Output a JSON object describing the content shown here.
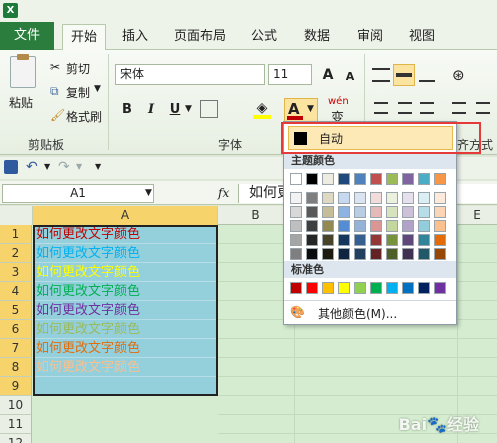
{
  "tabs": [
    {
      "label": "文件"
    },
    {
      "label": "开始"
    },
    {
      "label": "插入"
    },
    {
      "label": "页面布局"
    },
    {
      "label": "公式"
    },
    {
      "label": "数据"
    },
    {
      "label": "审阅"
    },
    {
      "label": "视图"
    }
  ],
  "ribbon": {
    "clipboard": {
      "paste": "粘贴",
      "cut": "剪切",
      "copy": "复制",
      "format_painter": "格式刷",
      "group": "剪贴板"
    },
    "font": {
      "name": "宋体",
      "size": "11",
      "group": "字体",
      "bold": "B",
      "italic": "I",
      "underline": "U",
      "font_color": "A",
      "grow": "A",
      "shrink": "A",
      "wen": "wén",
      "wen_char": "变"
    },
    "align": {
      "group": "对齐方式"
    }
  },
  "name_box": "A1",
  "fx_label": "fx",
  "formula_value": "如何更",
  "columns": [
    "A",
    "B",
    "E"
  ],
  "rows": [
    {
      "num": "1",
      "text": "如何更改文字颜色",
      "color": "#c00000"
    },
    {
      "num": "2",
      "text": "如何更改文字颜色",
      "color": "#00b0f0"
    },
    {
      "num": "3",
      "text": "如何更改文字颜色",
      "color": "#ffff00"
    },
    {
      "num": "4",
      "text": "如何更改文字颜色",
      "color": "#00b050"
    },
    {
      "num": "5",
      "text": "如何更改文字颜色",
      "color": "#7030a0"
    },
    {
      "num": "6",
      "text": "如何更改文字颜色",
      "color": "#9bbb59"
    },
    {
      "num": "7",
      "text": "如何更改文字颜色",
      "color": "#e36c09"
    },
    {
      "num": "8",
      "text": "如何更改文字颜色",
      "color": "#fac08f"
    },
    {
      "num": "9",
      "text": "",
      "color": "#000000"
    },
    {
      "num": "10",
      "text": "",
      "color": "#000000"
    },
    {
      "num": "11",
      "text": "",
      "color": "#000000"
    },
    {
      "num": "12",
      "text": "",
      "color": "#000000"
    }
  ],
  "color_menu": {
    "auto_label": "自动",
    "theme_title": "主题颜色",
    "standard_title": "标准色",
    "more_colors": "其他颜色(M)...",
    "theme_top": [
      "#ffffff",
      "#000000",
      "#eeece1",
      "#1f497d",
      "#4f81bd",
      "#c0504d",
      "#9bbb59",
      "#8064a2",
      "#4bacc6",
      "#f79646"
    ],
    "theme_shades": [
      [
        "#f2f2f2",
        "#7f7f7f",
        "#ddd9c3",
        "#c6d9f0",
        "#dbe5f1",
        "#f2dcdb",
        "#ebf1dd",
        "#e5e0ec",
        "#dbeef3",
        "#fdeada"
      ],
      [
        "#d8d8d8",
        "#595959",
        "#c4bd97",
        "#8db3e2",
        "#b8cce4",
        "#e5b9b7",
        "#d7e3bc",
        "#ccc1d9",
        "#b7dde8",
        "#fbd5b5"
      ],
      [
        "#bfbfbf",
        "#3f3f3f",
        "#938953",
        "#548dd4",
        "#95b3d7",
        "#d99694",
        "#c3d69b",
        "#b2a2c7",
        "#92cddc",
        "#fac08f"
      ],
      [
        "#a5a5a5",
        "#262626",
        "#494429",
        "#17365d",
        "#366092",
        "#953734",
        "#76923c",
        "#5f497a",
        "#31859b",
        "#e36c09"
      ],
      [
        "#7f7f7f",
        "#0c0c0c",
        "#1d1b10",
        "#0f243e",
        "#244061",
        "#632423",
        "#4f6128",
        "#3f3151",
        "#205867",
        "#974806"
      ]
    ],
    "standard": [
      "#c00000",
      "#ff0000",
      "#ffc000",
      "#ffff00",
      "#92d050",
      "#00b050",
      "#00b0f0",
      "#0070c0",
      "#002060",
      "#7030a0"
    ]
  },
  "watermark": "Bai🐾经验"
}
